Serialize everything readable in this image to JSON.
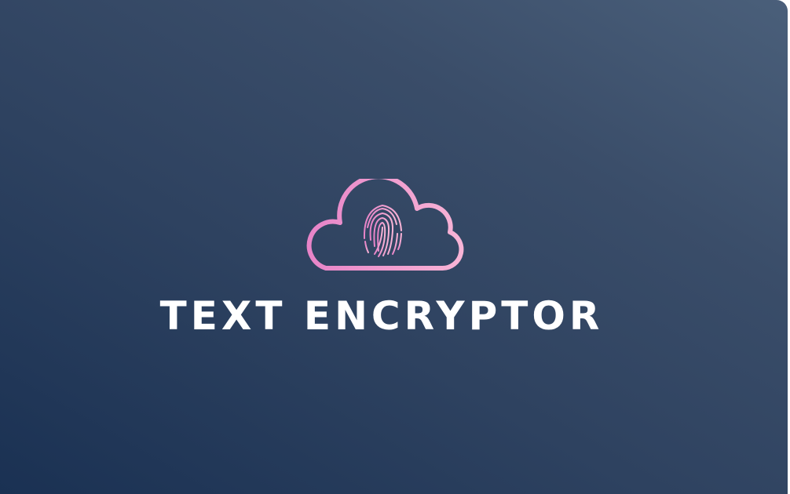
{
  "app": {
    "title": "TEXT ENCRYPTOR"
  },
  "logo": {
    "icon": "cloud-fingerprint-icon",
    "gradient_start": "#e784c8",
    "gradient_end": "#f8b4d6"
  },
  "colors": {
    "background_light": "#4a5f7a",
    "background_dark": "#1a3153",
    "title_text": "#ffffff"
  }
}
